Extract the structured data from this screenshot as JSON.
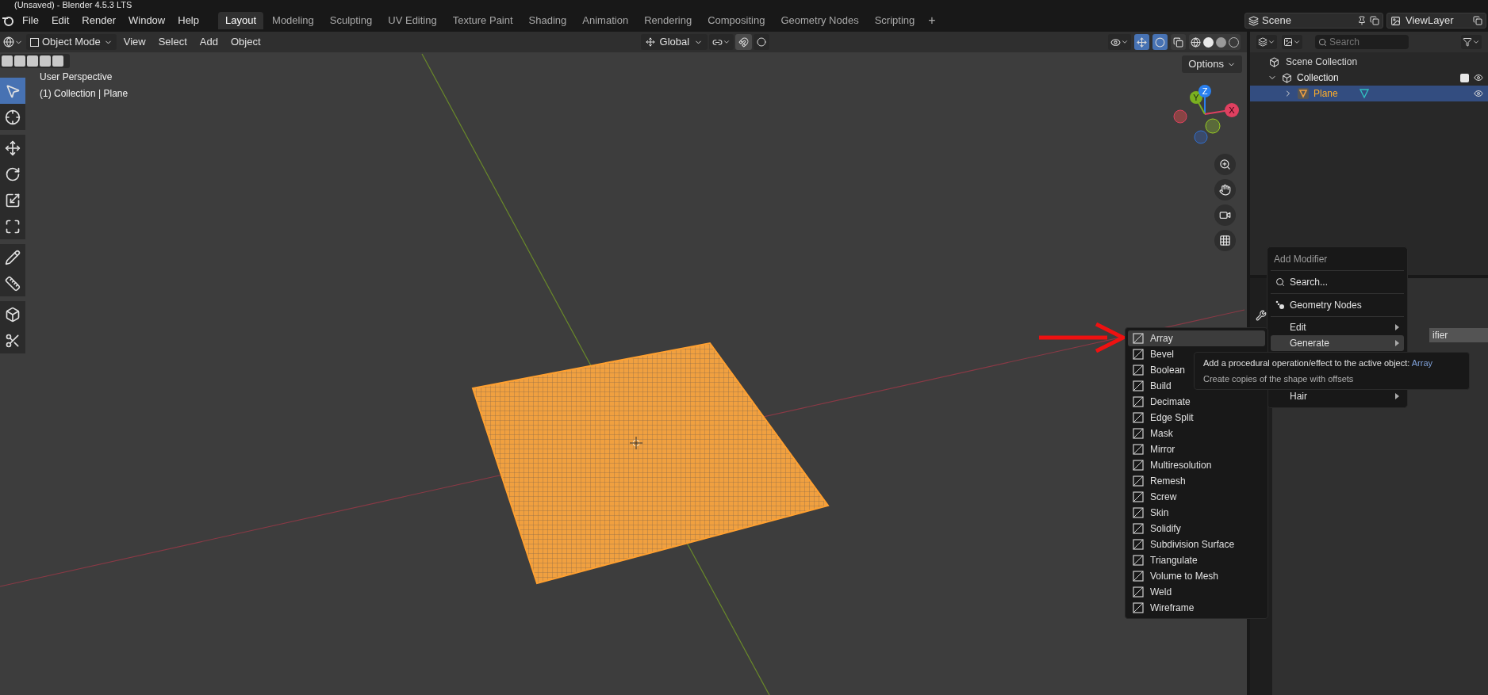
{
  "window": {
    "title": "(Unsaved) - Blender 4.5.3 LTS"
  },
  "menu_bar": [
    "File",
    "Edit",
    "Render",
    "Window",
    "Help"
  ],
  "workspace_tabs": [
    {
      "label": "Layout",
      "selected": true
    },
    {
      "label": "Modeling",
      "selected": false
    },
    {
      "label": "Sculpting",
      "selected": false
    },
    {
      "label": "UV Editing",
      "selected": false
    },
    {
      "label": "Texture Paint",
      "selected": false
    },
    {
      "label": "Shading",
      "selected": false
    },
    {
      "label": "Animation",
      "selected": false
    },
    {
      "label": "Rendering",
      "selected": false
    },
    {
      "label": "Compositing",
      "selected": false
    },
    {
      "label": "Geometry Nodes",
      "selected": false
    },
    {
      "label": "Scripting",
      "selected": false
    }
  ],
  "add_workspace": "+",
  "scene": {
    "value": "Scene"
  },
  "view_layer": {
    "value": "ViewLayer"
  },
  "viewport_header": {
    "mode": "Object Mode",
    "menus": [
      "View",
      "Select",
      "Add",
      "Object"
    ],
    "orientation": "Global"
  },
  "viewport": {
    "options": "Options",
    "perspective": "User Perspective",
    "context": "(1) Collection | Plane",
    "axes": [
      "Z",
      "Y",
      "X"
    ]
  },
  "toolbar": [
    {
      "selected": true
    },
    {
      "selected": false
    },
    {
      "selected": false
    },
    {
      "selected": false
    },
    {
      "selected": false
    },
    {
      "selected": false
    },
    {
      "selected": false
    },
    {
      "selected": false
    },
    {
      "selected": false
    },
    {
      "selected": false
    }
  ],
  "outliner": {
    "search": {
      "placeholder": "Search"
    },
    "root": "Scene Collection",
    "items": [
      {
        "label": "Collection",
        "expanded": true,
        "checked": true,
        "selected": false,
        "children": [
          {
            "label": "Plane",
            "expanded": false,
            "selected": true
          }
        ]
      }
    ]
  },
  "properties": {
    "button_text": "ifier"
  },
  "add_modifier_menu": {
    "title": "Add Modifier",
    "items": [
      {
        "kind": "search",
        "label": "Search..."
      },
      {
        "kind": "separator"
      },
      {
        "kind": "action",
        "label": "Geometry Nodes"
      },
      {
        "kind": "separator"
      },
      {
        "kind": "submenu",
        "label": "Edit",
        "selected": false
      },
      {
        "kind": "submenu",
        "label": "Generate",
        "selected": true
      },
      {
        "kind": "covered"
      },
      {
        "kind": "covered"
      },
      {
        "kind": "separator"
      },
      {
        "kind": "submenu",
        "label": "Hair",
        "selected": false
      }
    ]
  },
  "generate_menu": [
    {
      "label": "Array",
      "selected": true
    },
    {
      "label": "Bevel",
      "selected": false
    },
    {
      "label": "Boolean",
      "selected": false
    },
    {
      "label": "Build",
      "selected": false
    },
    {
      "label": "Decimate",
      "selected": false
    },
    {
      "label": "Edge Split",
      "selected": false
    },
    {
      "label": "Mask",
      "selected": false
    },
    {
      "label": "Mirror",
      "selected": false
    },
    {
      "label": "Multiresolution",
      "selected": false
    },
    {
      "label": "Remesh",
      "selected": false
    },
    {
      "label": "Screw",
      "selected": false
    },
    {
      "label": "Skin",
      "selected": false
    },
    {
      "label": "Solidify",
      "selected": false
    },
    {
      "label": "Subdivision Surface",
      "selected": false
    },
    {
      "label": "Triangulate",
      "selected": false
    },
    {
      "label": "Volume to Mesh",
      "selected": false
    },
    {
      "label": "Weld",
      "selected": false
    },
    {
      "label": "Wireframe",
      "selected": false
    }
  ],
  "tooltip": {
    "text": "Add a procedural operation/effect to the active object:",
    "highlight": "Array",
    "description": "Create copies of the shape with offsets"
  }
}
